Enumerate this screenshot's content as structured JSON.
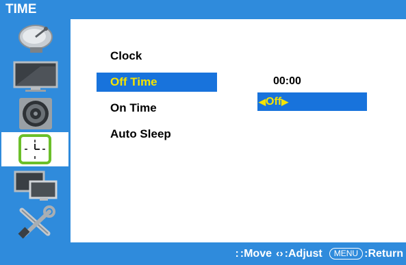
{
  "header": {
    "title": "TIME"
  },
  "sidebar": {
    "items": [
      {
        "icon": "satellite-dish-icon"
      },
      {
        "icon": "monitor-icon"
      },
      {
        "icon": "speaker-icon"
      },
      {
        "icon": "clock-icon",
        "active": true
      },
      {
        "icon": "pip-screens-icon"
      },
      {
        "icon": "tools-icon"
      }
    ]
  },
  "menu": {
    "items": [
      {
        "label": "Clock"
      },
      {
        "label": "Off Time",
        "selected": true
      },
      {
        "label": "On Time"
      },
      {
        "label": "Auto Sleep"
      }
    ]
  },
  "values": {
    "clock_time": "00:00",
    "off_time_value": "Off"
  },
  "footer": {
    "move_glyph": ":",
    "move_label": ":Move",
    "adjust_glyph": "‹›",
    "adjust_label": ":Adjust",
    "menu_key": "MENU",
    "return_label": ":Return"
  },
  "colors": {
    "frame_blue": "#2f8bdc",
    "highlight_blue": "#1873dc",
    "highlight_text": "#f5e400",
    "active_icon_green": "#6bbf2a"
  }
}
